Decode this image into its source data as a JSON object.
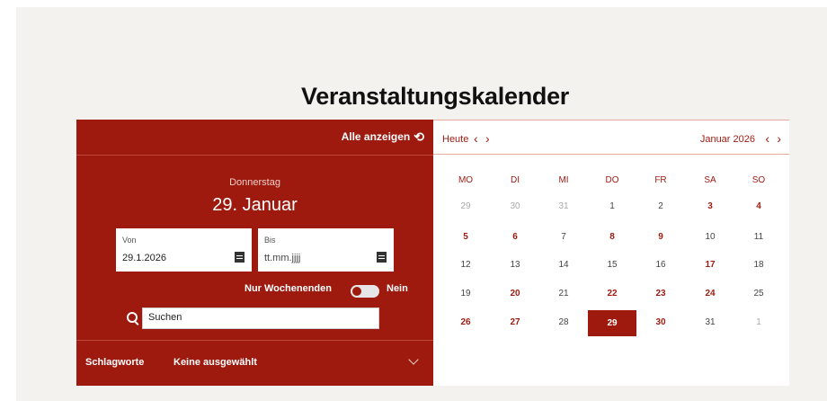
{
  "page": {
    "title": "Veranstaltungskalender"
  },
  "filter": {
    "show_all_label": "Alle anzeigen",
    "weekday": "Donnerstag",
    "date": "29. Januar",
    "from_label": "Von",
    "from_value": "29.1.2026",
    "to_label": "Bis",
    "to_placeholder": "tt.mm.jjjj",
    "weekend_label": "Nur Wochenenden",
    "weekend_value": "Nein",
    "search_placeholder": "Suchen",
    "tags_label": "Schlagworte",
    "tags_value": "Keine ausgewählt"
  },
  "calendar": {
    "today_label": "Heute",
    "month_label": "Januar 2026",
    "prev": "‹",
    "next": "›",
    "weekdays": [
      "MO",
      "DI",
      "MI",
      "DO",
      "FR",
      "SA",
      "SO"
    ],
    "weeks": [
      [
        "29",
        "30",
        "31",
        "1",
        "2",
        "3",
        "4"
      ],
      [
        "5",
        "6",
        "7",
        "8",
        "9",
        "10",
        "11"
      ],
      [
        "12",
        "13",
        "14",
        "15",
        "16",
        "17",
        "18"
      ],
      [
        "19",
        "20",
        "21",
        "22",
        "23",
        "24",
        "25"
      ],
      [
        "26",
        "27",
        "28",
        "29",
        "30",
        "31",
        "1"
      ]
    ],
    "styles": [
      [
        "muted",
        "muted",
        "muted",
        "",
        "",
        "bold",
        "bold"
      ],
      [
        "bold",
        "bold",
        "",
        "bold",
        "bold",
        "",
        ""
      ],
      [
        "",
        "",
        "",
        "",
        "",
        "bold",
        ""
      ],
      [
        "",
        "bold",
        "",
        "bold",
        "bold",
        "bold",
        ""
      ],
      [
        "bold",
        "bold",
        "",
        "sel",
        "bold",
        "",
        "muted"
      ]
    ]
  },
  "colors": {
    "accent": "#9e1a0f"
  },
  "icons": {
    "reset": "refresh-icon",
    "calendar": "calendar-icon",
    "search": "search-icon",
    "expand": "chevron-down-icon"
  }
}
